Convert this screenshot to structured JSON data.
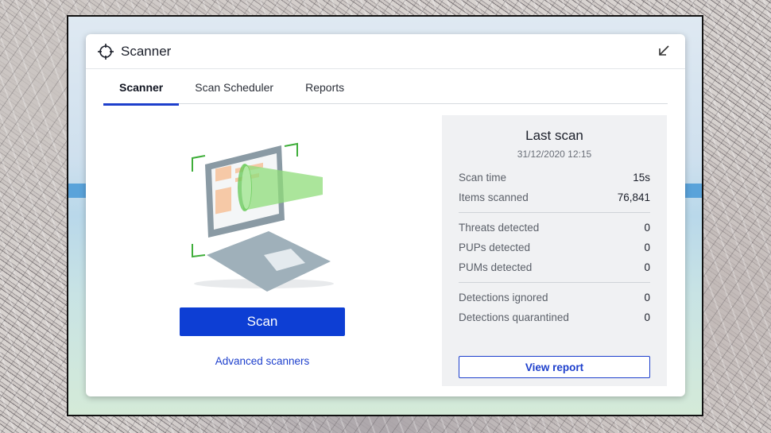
{
  "window": {
    "title": "Scanner"
  },
  "tabs": [
    {
      "label": "Scanner",
      "active": true
    },
    {
      "label": "Scan Scheduler",
      "active": false
    },
    {
      "label": "Reports",
      "active": false
    }
  ],
  "main": {
    "scan_button": "Scan",
    "advanced_link": "Advanced scanners"
  },
  "last_scan": {
    "title": "Last scan",
    "date": "31/12/2020 12:15",
    "rows": [
      {
        "label": "Scan time",
        "value": "15s"
      },
      {
        "label": "Items scanned",
        "value": "76,841"
      },
      {
        "label": "Threats detected",
        "value": "0"
      },
      {
        "label": "PUPs detected",
        "value": "0"
      },
      {
        "label": "PUMs detected",
        "value": "0"
      },
      {
        "label": "Detections ignored",
        "value": "0"
      },
      {
        "label": "Detections quarantined",
        "value": "0"
      }
    ],
    "view_report": "View report"
  },
  "colors": {
    "accent": "#0d3ed4",
    "panel": "#f0f1f3",
    "scan_beam": "#8fdc7a",
    "bracket": "#3fae3a"
  },
  "icons": {
    "title": "crosshair-icon",
    "collapse": "arrow-down-left-icon",
    "illustration": "laptop-scan-illustration"
  }
}
